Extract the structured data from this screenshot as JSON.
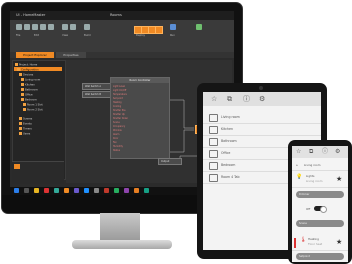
{
  "desktop": {
    "window_title": "UI - HomeMaster",
    "center_title": "Rooms",
    "ribbon_labels": [
      "File",
      "Edit",
      "View",
      "Build",
      "Deploy",
      "Run"
    ],
    "tabs": [
      "Project Explorer",
      "Properties"
    ],
    "tree_items": [
      "Project: Home",
      "Configuration",
      "Devices",
      "Living room",
      "Kitchen",
      "Bathroom",
      "Office",
      "Bedroom",
      "Room 1 Slot",
      "Room 2 Slot",
      "Scenes",
      "Events",
      "Timers",
      "Users"
    ],
    "node_big_title": "Room Controller",
    "node_rows": [
      "Light Level",
      "Light On/Off",
      "Temperature",
      "Set point",
      "Heating",
      "Cooling",
      "Shutter Pos",
      "Shutter Up",
      "Shutter Down",
      "Scene",
      "Occupancy",
      "Window",
      "Alarm",
      "Door",
      "Fan",
      "Humidity",
      "Status"
    ],
    "node_a": "Wall Switch A",
    "node_b": "Wall Switch B",
    "node_c": "Output",
    "accent": "#f08a24"
  },
  "tablet": {
    "rooms": [
      "Living room",
      "Kitchen",
      "Bathroom",
      "Office",
      "Bedroom",
      "Room 4 Tab"
    ],
    "toolbar_icons": [
      "star-icon",
      "export-icon",
      "info-icon",
      "gear-icon"
    ]
  },
  "phone": {
    "header": "Living room",
    "light_title": "Lights",
    "light_sub": "Living room",
    "pill_1": "Dimmer",
    "pill_2": "Scene",
    "toggle_label": "Off",
    "heating_title": "Heating",
    "heating_sub": "Floor heat",
    "pill_3": "Setpoint"
  }
}
